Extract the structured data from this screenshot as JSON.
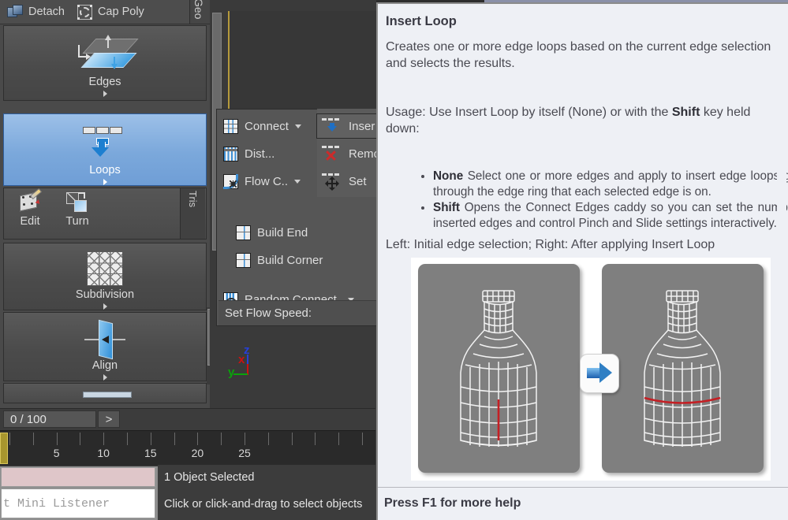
{
  "ribbon": {
    "top_buttons": [
      {
        "label": "Detach",
        "icon": "detach-icon"
      },
      {
        "label": "Cap Poly",
        "icon": "cap-poly-icon"
      }
    ],
    "vertical_tab_geo": "Geo",
    "vertical_tab_tris": "Tris",
    "panels": [
      {
        "label": "Edges",
        "icon": "edges-icon",
        "selected": false
      },
      {
        "label": "Loops",
        "icon": "loops-icon",
        "selected": true
      },
      {
        "label": "Subdivision",
        "icon": "subdivision-icon",
        "selected": false
      },
      {
        "label": "Align",
        "icon": "align-icon",
        "selected": false
      }
    ],
    "small_buttons": [
      {
        "label": "Edit",
        "icon": "edit-icon"
      },
      {
        "label": "Turn",
        "icon": "turn-icon"
      }
    ]
  },
  "flyout": {
    "left_column": [
      {
        "label": "Connect",
        "icon": "connect-grid-icon",
        "has_dropdown": true
      },
      {
        "label": "Dist...",
        "icon": "distribute-icon",
        "has_dropdown": false
      },
      {
        "label": "Flow C..",
        "icon": "flow-connect-icon",
        "has_dropdown": true
      }
    ],
    "right_column": [
      {
        "label": "Inser",
        "icon": "insert-loop-icon",
        "hovered": true
      },
      {
        "label": "Remo",
        "icon": "remove-loop-icon",
        "hovered": false
      },
      {
        "label": "Set",
        "icon": "set-loop-icon",
        "hovered": false
      }
    ],
    "build_items": [
      {
        "label": "Build End",
        "icon": "build-end-icon"
      },
      {
        "label": "Build Corner",
        "icon": "build-corner-icon"
      }
    ],
    "random_connect": {
      "label": "Random Connect",
      "icon": "random-connect-icon",
      "has_dropdown": true
    },
    "flow_speed_label": "Set Flow Speed:"
  },
  "viewport": {
    "axis_gizmo": {
      "z": "z",
      "x": "x",
      "y": "y"
    }
  },
  "timeline": {
    "frame_field": "0 / 100",
    "go_button": ">",
    "ruler_ticks": [
      "5",
      "10",
      "15",
      "20",
      "25"
    ]
  },
  "listener": {
    "mini_listener_text": "t Mini Listener"
  },
  "status": {
    "selection": "1 Object Selected",
    "prompt": "Click or click-and-drag to select objects"
  },
  "tooltip": {
    "title": "Insert Loop",
    "description": "Creates one or more edge loops based on the current edge selection and selects the results.",
    "usage_prefix": "Usage: Use Insert Loop by itself (None) or with the ",
    "usage_bold": "Shift",
    "usage_suffix": " key held down:",
    "bullets": [
      {
        "term": "None",
        "text": " Select one or more edges and apply to insert edge loops going through the edge ring that each selected edge is on."
      },
      {
        "term": "Shift",
        "text": " Opens the Connect Edges caddy so you can set the number of inserted edges and control Pinch and Slide settings interactively."
      }
    ],
    "caption": "Left: Initial edge selection; Right: After applying Insert Loop",
    "image_left_alt": "wireframe-bottle-initial-selection",
    "image_right_alt": "wireframe-bottle-after-insert-loop",
    "arrow_alt": "right-arrow-icon",
    "footer": "Press F1 for more help"
  },
  "colors": {
    "selected_panel": "#7ba8db",
    "tooltip_bg": "#eef0f5",
    "ribbon_bg": "#4a4a4a",
    "accent_red": "#cc2b2b",
    "accent_blue": "#1f6fc4"
  }
}
